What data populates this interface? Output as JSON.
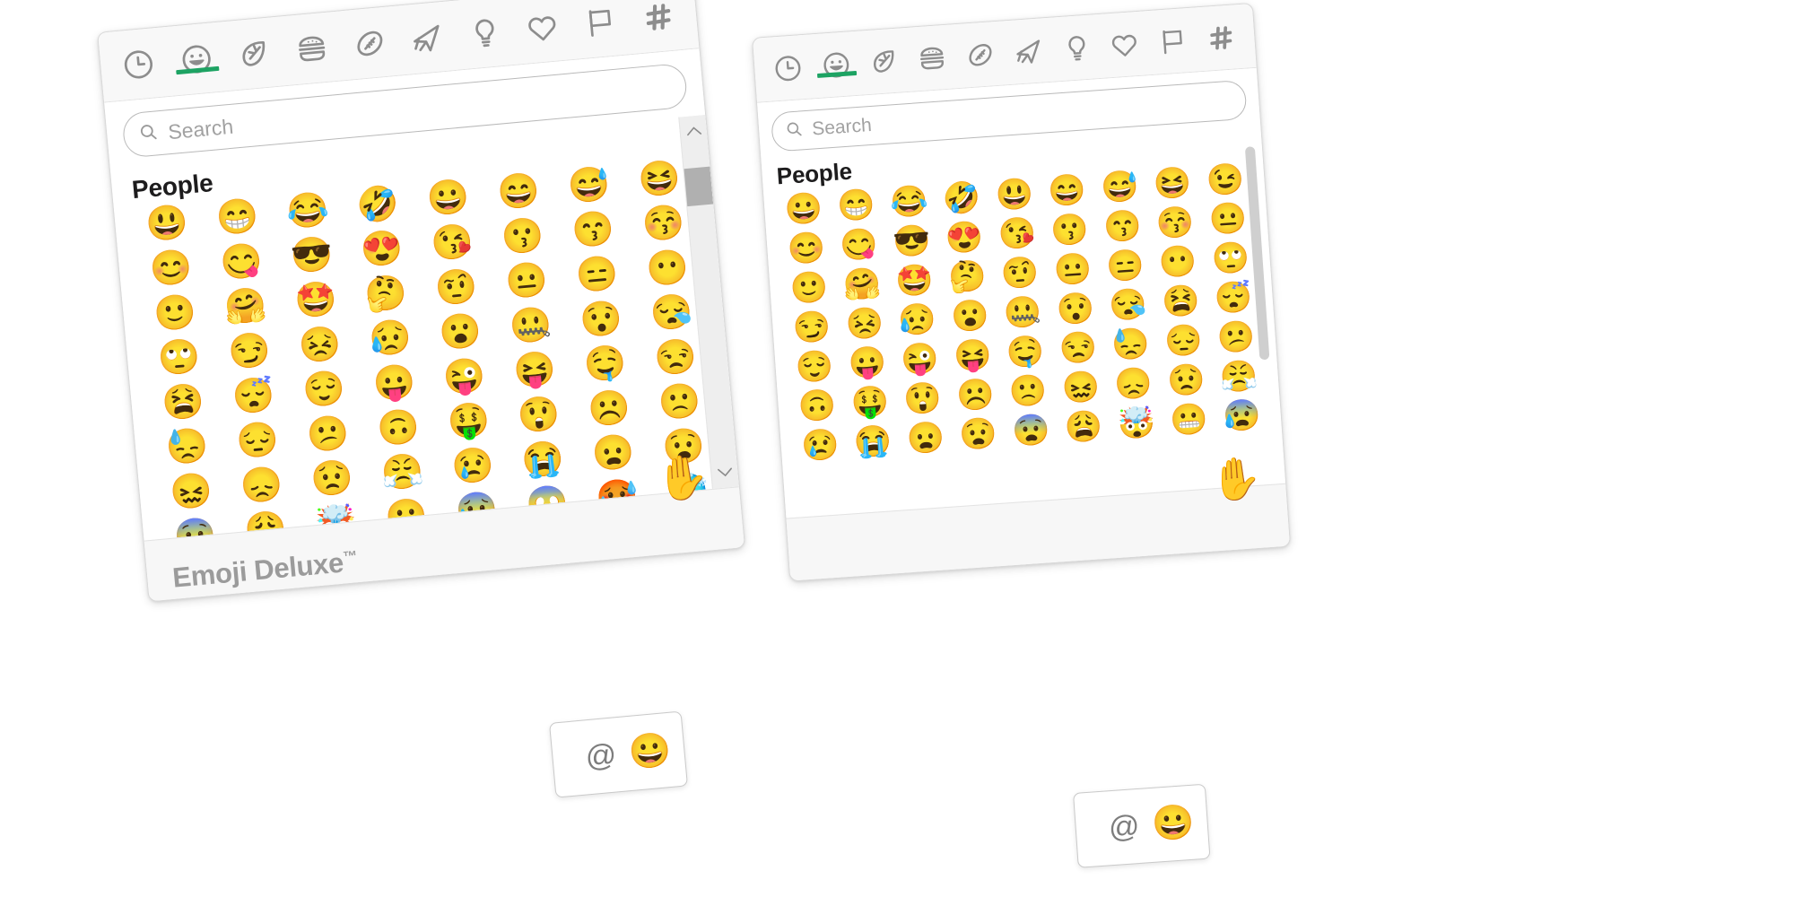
{
  "theme": {
    "accent_green": "#1DA363",
    "panel_bg": "#ffffff",
    "tabbar_bg": "#f8f8f8",
    "footer_bg": "#f7f7f7",
    "border": "#d9d9d9",
    "icon_gray": "#8d8d8d",
    "placeholder_gray": "#a2a2a2",
    "brand_gray": "#9b9b9b",
    "heading_dark": "#1d1c1d"
  },
  "tabs": [
    {
      "name": "recent",
      "icon": "clock-icon",
      "active": false
    },
    {
      "name": "people",
      "icon": "smiley-icon",
      "active": true
    },
    {
      "name": "nature",
      "icon": "leaf-icon",
      "active": false
    },
    {
      "name": "food",
      "icon": "burger-icon",
      "active": false
    },
    {
      "name": "activity",
      "icon": "football-icon",
      "active": false
    },
    {
      "name": "travel",
      "icon": "airplane-icon",
      "active": false
    },
    {
      "name": "objects",
      "icon": "lightbulb-icon",
      "active": false
    },
    {
      "name": "symbols",
      "icon": "heart-icon",
      "active": false
    },
    {
      "name": "flags",
      "icon": "flag-icon",
      "active": false
    },
    {
      "name": "custom",
      "icon": "hash-icon",
      "active": false
    }
  ],
  "search": {
    "placeholder": "Search",
    "value": "",
    "icon": "search-icon"
  },
  "section": {
    "title": "People"
  },
  "brand": {
    "name": "Emoji Deluxe",
    "trademark": "™"
  },
  "footer": {
    "hand_emoji": "✋"
  },
  "composer": {
    "mention_label": "@",
    "mention_icon": "at-mention-icon",
    "emoji_button": "😀",
    "emoji_icon": "emoji-picker-icon"
  },
  "scrollbar_left": {
    "style": "classic",
    "up_arrow": "⌃",
    "down_arrow": "⌄",
    "thumb_top_pct": 7,
    "thumb_height_pct": 12
  },
  "scrollbar_right": {
    "style": "modern",
    "thumb_top_pct": 4,
    "thumb_height_pct": 62
  },
  "panels": [
    {
      "id": "left-panel",
      "label": "emoji-picker-left",
      "rotation_deg": -5.2,
      "emoji_rows": [
        [
          "😃",
          "😁",
          "😂",
          "🤣",
          "😀",
          "😄",
          "😅",
          "😆"
        ],
        [
          "😊",
          "😋",
          "😎",
          "😍",
          "😘",
          "😗",
          "😙",
          "😚"
        ],
        [
          "🙂",
          "🤗",
          "🤩",
          "🤔",
          "🤨",
          "😐",
          "😑",
          "😶"
        ],
        [
          "🙄",
          "😏",
          "😣",
          "😥",
          "😮",
          "🤐",
          "😯",
          "😪"
        ],
        [
          "😫",
          "😴",
          "😌",
          "😛",
          "😜",
          "😝",
          "🤤",
          "😒"
        ],
        [
          "😓",
          "😔",
          "😕",
          "🙃",
          "🤑",
          "😲",
          "☹️",
          "🙁"
        ],
        [
          "😖",
          "😞",
          "😟",
          "😤",
          "😢",
          "😭",
          "😦",
          "😧"
        ],
        [
          "😨",
          "😩",
          "🤯",
          "😬",
          "😰",
          "😱",
          "🥵",
          "🥶"
        ]
      ]
    },
    {
      "id": "right-panel",
      "label": "emoji-picker-right",
      "rotation_deg": -4.0,
      "emoji_rows": [
        [
          "😀",
          "😁",
          "😂",
          "🤣",
          "😃",
          "😄",
          "😅",
          "😆",
          "😉"
        ],
        [
          "😊",
          "😋",
          "😎",
          "😍",
          "😘",
          "😗",
          "😙",
          "😚",
          "😐"
        ],
        [
          "🙂",
          "🤗",
          "🤩",
          "🤔",
          "🤨",
          "😐",
          "😑",
          "😶",
          "🙄"
        ],
        [
          "😏",
          "😣",
          "😥",
          "😮",
          "🤐",
          "😯",
          "😪",
          "😫",
          "😴"
        ],
        [
          "😌",
          "😛",
          "😜",
          "😝",
          "🤤",
          "😒",
          "😓",
          "😔",
          "😕"
        ],
        [
          "🙃",
          "🤑",
          "😲",
          "☹️",
          "🙁",
          "😖",
          "😞",
          "😟",
          "😤"
        ],
        [
          "😢",
          "😭",
          "😦",
          "😧",
          "😨",
          "😩",
          "🤯",
          "😬",
          "😰"
        ]
      ]
    }
  ]
}
